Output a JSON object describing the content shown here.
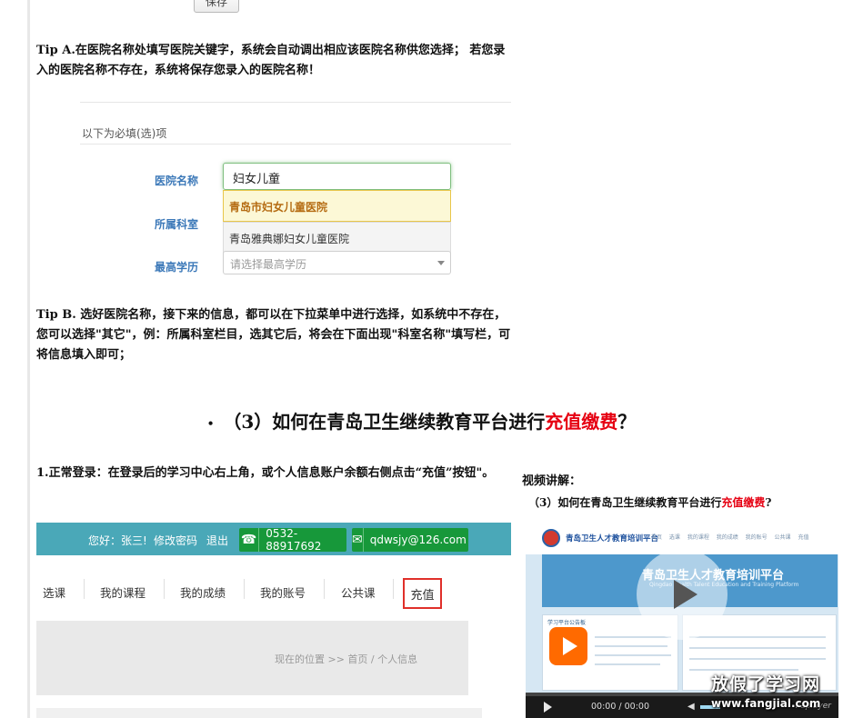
{
  "top_form": {
    "save_label": "保存"
  },
  "tip_a": "Tip A.在医院名称处填写医院关键字，系统会自动调出相应该医院名称供您选择； 若您录入的医院名称不存在，系统将保存您录入的医院名称！",
  "form": {
    "section_title": "以下为必填(选)项",
    "hospital_label": "医院名称",
    "hospital_value": "妇女儿童",
    "suggestions": [
      "青岛市妇女儿童医院",
      "青岛雅典娜妇女儿童医院"
    ],
    "department_label": "所属科室",
    "education_label": "最高学历",
    "education_placeholder": "请选择最高学历"
  },
  "tip_b": "Tip B. 选好医院名称，接下来的信息，都可以在下拉菜单中进行选择，如系统中不存在，您可以选择\"其它\"，例：所属科室栏目，选其它后，将会在下面出现\"科室名称\"填写栏，可将信息填入即可；",
  "heading": {
    "bullet": "•",
    "prefix": "（3）如何在青岛卫生继续教育平台进行",
    "highlight": "充值缴费",
    "suffix": "？"
  },
  "step1": "1.正常登录：在登录后的学习中心右上角，或个人信息账户余额右侧点击“充值”按钮\"。",
  "learning_center": {
    "greeting": "您好：张三!",
    "change_password": "修改密码",
    "logout": "退出",
    "phone": "0532-88917692",
    "email": "qdwsjy@126.com",
    "nav": [
      "选课",
      "我的课程",
      "我的成绩",
      "我的账号",
      "公共课"
    ],
    "recharge": "充值",
    "breadcrumb": "现在的位置 >> 首页 / 个人信息"
  },
  "video": {
    "label": "视频讲解：",
    "title_prefix": "（3）如何在青岛卫生继续教育平台进行",
    "title_highlight": "充值缴费",
    "title_suffix": "?",
    "preview_site": "青岛卫生人才教育培训平台",
    "preview_nav": "首页 选课 我的课程 我的成绩 我的账号 公共课 充值",
    "preview_banner": "青岛卫生人才教育培训平台",
    "preview_banner_sub": "Qingdao Health Talent Education and Training Platform",
    "preview_board": "学习平台公告板",
    "time": "00:00 / 00:00",
    "player_brand": "Paplayer"
  },
  "watermark": {
    "cn": "放假了学习网",
    "url": "www.fangjial.com"
  },
  "colors": {
    "accent_red": "#e60012",
    "teal_bar": "#4aa8b8",
    "contact_green": "#17983a"
  }
}
